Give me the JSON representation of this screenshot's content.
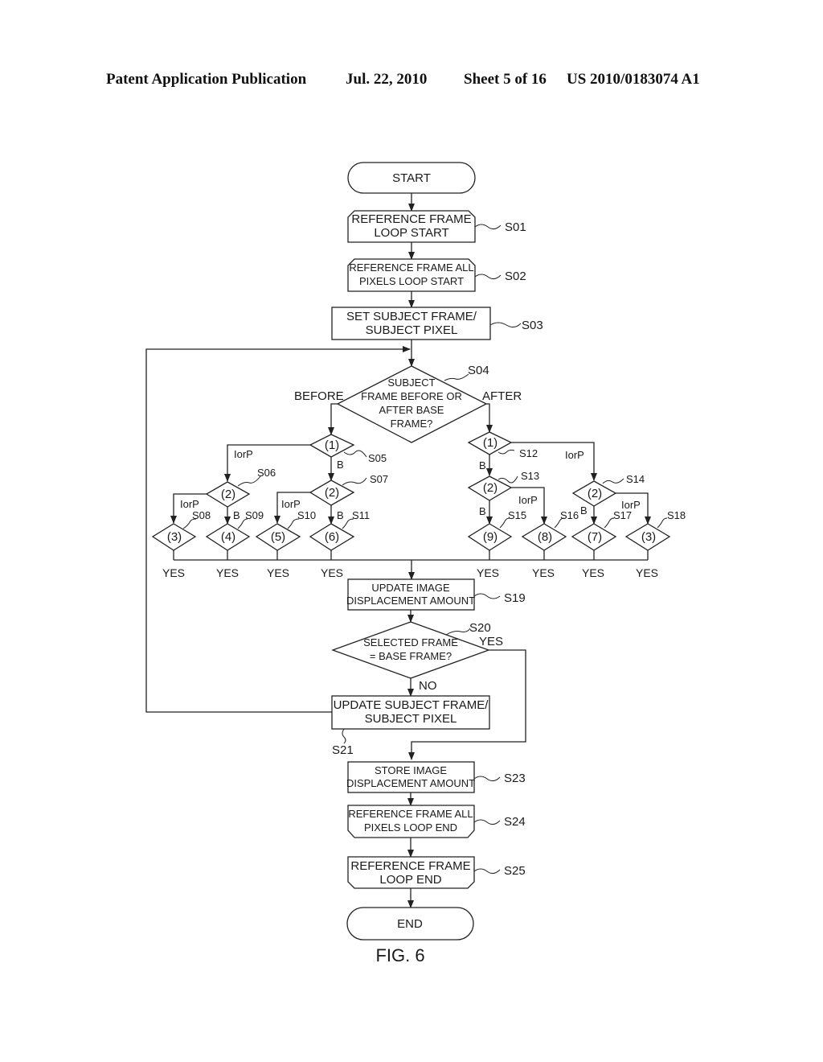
{
  "header": {
    "publication": "Patent Application Publication",
    "date": "Jul. 22, 2010",
    "sheet": "Sheet 5 of 16",
    "number": "US 2010/0183074 A1"
  },
  "figure_label": "FIG. 6",
  "nodes": {
    "start": {
      "text": "START"
    },
    "s01": {
      "step": "S01",
      "lines": [
        "REFERENCE FRAME",
        "LOOP START"
      ]
    },
    "s02": {
      "step": "S02",
      "lines": [
        "REFERENCE FRAME ALL",
        "PIXELS LOOP START"
      ]
    },
    "s03": {
      "step": "S03",
      "lines": [
        "SET SUBJECT FRAME/",
        "SUBJECT PIXEL"
      ]
    },
    "s04": {
      "step": "S04",
      "lines": [
        "SUBJECT",
        "FRAME BEFORE OR",
        "AFTER BASE",
        "FRAME?"
      ],
      "left_label": "BEFORE",
      "right_label": "AFTER"
    },
    "s05": {
      "step": "S05",
      "text": "(1)"
    },
    "s06": {
      "step": "S06",
      "text": "(2)"
    },
    "s07": {
      "step": "S07",
      "text": "(2)"
    },
    "s08": {
      "step": "S08",
      "text": "(3)"
    },
    "s09": {
      "step": "S09",
      "text": "(4)"
    },
    "s10": {
      "step": "S10",
      "text": "(5)"
    },
    "s11": {
      "step": "S11",
      "text": "(6)"
    },
    "s12": {
      "step": "S12",
      "text": "(1)"
    },
    "s13": {
      "step": "S13",
      "text": "(2)"
    },
    "s14": {
      "step": "S14",
      "text": "(2)"
    },
    "s15": {
      "step": "S15",
      "text": "(9)"
    },
    "s16": {
      "step": "S16",
      "text": "(8)"
    },
    "s17": {
      "step": "S17",
      "text": "(7)"
    },
    "s18": {
      "step": "S18",
      "text": "(3)"
    },
    "s19": {
      "step": "S19",
      "lines": [
        "UPDATE IMAGE",
        "DISPLACEMENT AMOUNT"
      ]
    },
    "s20": {
      "step": "S20",
      "lines": [
        "SELECTED FRAME",
        "= BASE FRAME?"
      ],
      "yes_label": "YES",
      "no_label": "NO"
    },
    "s21": {
      "step": "S21",
      "lines": [
        "UPDATE SUBJECT FRAME/",
        "SUBJECT PIXEL"
      ]
    },
    "s23": {
      "step": "S23",
      "lines": [
        "STORE IMAGE",
        "DISPLACEMENT AMOUNT"
      ]
    },
    "s24": {
      "step": "S24",
      "lines": [
        "REFERENCE FRAME ALL",
        "PIXELS LOOP END"
      ]
    },
    "s25": {
      "step": "S25",
      "lines": [
        "REFERENCE FRAME",
        "LOOP END"
      ]
    },
    "end": {
      "text": "END"
    }
  },
  "edge_labels": {
    "iorp": "IorP",
    "b": "B",
    "yes": "YES"
  }
}
